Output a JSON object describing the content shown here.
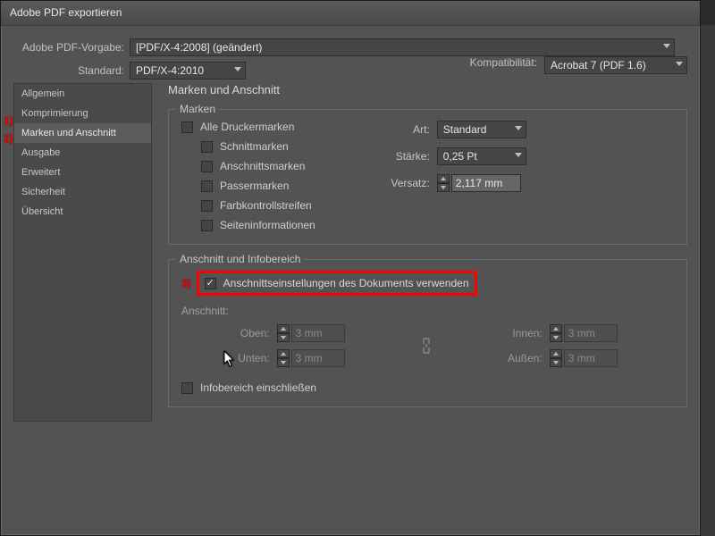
{
  "title": "Adobe PDF exportieren",
  "preset_label": "Adobe PDF-Vorgabe:",
  "preset_value": "[PDF/X-4:2008] (geändert)",
  "standard_label": "Standard:",
  "standard_value": "PDF/X-4:2010",
  "compat_label": "Kompatibilität:",
  "compat_value": "Acrobat 7 (PDF 1.6)",
  "sidebar": {
    "items": [
      {
        "label": "Allgemein"
      },
      {
        "label": "Komprimierung"
      },
      {
        "label": "Marken und Anschnitt"
      },
      {
        "label": "Ausgabe"
      },
      {
        "label": "Erweitert"
      },
      {
        "label": "Sicherheit"
      },
      {
        "label": "Übersicht"
      }
    ],
    "selected_index": 2
  },
  "markers": {
    "one": "1)",
    "two": "2)",
    "three": "3)"
  },
  "panel": {
    "title": "Marken und Anschnitt",
    "marks_legend": "Marken",
    "marks": {
      "all": "Alle Druckermarken",
      "crop": "Schnittmarken",
      "bleed": "Anschnittsmarken",
      "registration": "Passermarken",
      "colorbars": "Farbkontrollstreifen",
      "pageinfo": "Seiteninformationen"
    },
    "props": {
      "type_label": "Art:",
      "type_value": "Standard",
      "weight_label": "Stärke:",
      "weight_value": "0,25 Pt",
      "offset_label": "Versatz:",
      "offset_value": "2,117 mm"
    },
    "bleed_legend": "Anschnitt und Infobereich",
    "use_doc_bleed": "Anschnittseinstellungen des Dokuments verwenden",
    "bleed_sub": "Anschnitt:",
    "bleed": {
      "top_label": "Oben:",
      "bottom_label": "Unten:",
      "inner_label": "Innen:",
      "outer_label": "Außen:",
      "value": "3 mm"
    },
    "include_slug": "Infobereich einschließen"
  }
}
